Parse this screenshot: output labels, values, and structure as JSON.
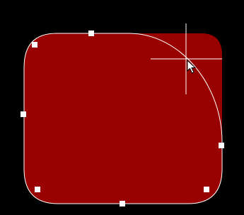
{
  "canvas": {
    "background_color": "#000000"
  },
  "shape": {
    "kind": "rounded-rectangle",
    "fill_color": "#990000",
    "outline_color": "#ffffff",
    "selected": true,
    "handle_color": "#ffffff",
    "handle_count": 7,
    "editing_corner": "top-right"
  },
  "cursor": {
    "crosshair_color": "#ffffff",
    "pointer_icon": "arrow-pointer-icon"
  }
}
